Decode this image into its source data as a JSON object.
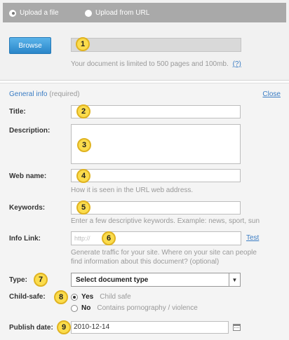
{
  "upload": {
    "option_file": "Upload a file",
    "option_url": "Upload from URL",
    "selected": "file",
    "browse_label": "Browse",
    "limit_note": "Your document is limited to 500 pages and 100mb.",
    "help_link": "(?)"
  },
  "info": {
    "heading": "General info",
    "required_label": "(required)",
    "close_label": "Close",
    "title_label": "Title:",
    "description_label": "Description:",
    "webname_label": "Web name:",
    "webname_hint": "How it is seen in the URL web address.",
    "keywords_label": "Keywords:",
    "keywords_hint": "Enter a few descriptive keywords. Example: news, sport, sun",
    "infolink_label": "Info Link:",
    "infolink_placeholder": "http://",
    "test_label": "Test",
    "infolink_hint_1": "Generate traffic for your site. Where on your site can people",
    "infolink_hint_2": "find information about this document? (optional)",
    "type_label": "Type:",
    "type_value": "Select document type",
    "childsafe_label": "Child-safe:",
    "yes_label": "Yes",
    "yes_desc": "Child safe",
    "no_label": "No",
    "no_desc": "Contains pornography / violence",
    "childsafe_selected": "yes",
    "publish_label": "Publish date:",
    "publish_value": "2010-12-14"
  },
  "markers": [
    "1",
    "2",
    "3",
    "4",
    "5",
    "6",
    "7",
    "8",
    "9"
  ],
  "colors": {
    "browse_button": "#2a86c9",
    "link": "#3b7dc4",
    "marker_fill": "#fbdc4c",
    "upload_bar": "#a9a9a9"
  }
}
